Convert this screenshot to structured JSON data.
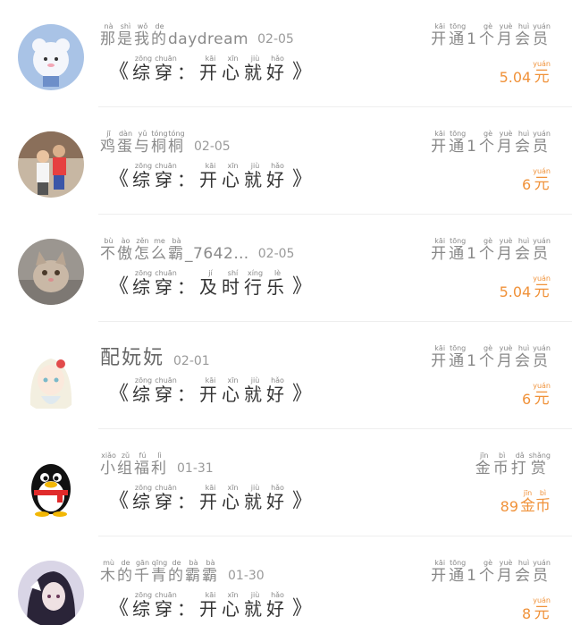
{
  "rows": [
    {
      "name_ruby": [
        [
          "那",
          "nà"
        ],
        [
          "是",
          "shì"
        ],
        [
          "我",
          "wǒ"
        ],
        [
          "的",
          "de"
        ]
      ],
      "name_tail": "daydream",
      "date": "02-05",
      "work": [
        [
          "综",
          "zōng"
        ],
        [
          "穿",
          "chuān"
        ],
        [
          "：",
          ""
        ],
        [
          "开",
          "kāi"
        ],
        [
          "心",
          "xīn"
        ],
        [
          "就",
          "jiù"
        ],
        [
          "好",
          "hǎo"
        ]
      ],
      "action": [
        [
          "开",
          "kāi"
        ],
        [
          "通",
          "tōng"
        ],
        [
          "1",
          ""
        ],
        [
          "个",
          "gè"
        ],
        [
          "月",
          "yuè"
        ],
        [
          "会",
          "huì"
        ],
        [
          "员",
          "yuán"
        ]
      ],
      "amount": "5.04",
      "currency": [
        [
          "元",
          "yuán"
        ]
      ],
      "avatar": "cloud-bear-icon"
    },
    {
      "name_ruby": [
        [
          "鸡",
          "jī"
        ],
        [
          "蛋",
          "dàn"
        ],
        [
          "与",
          "yǔ"
        ],
        [
          "桐",
          "tóng"
        ],
        [
          "桐",
          "tóng"
        ]
      ],
      "name_tail": "",
      "date": "02-05",
      "work": [
        [
          "综",
          "zōng"
        ],
        [
          "穿",
          "chuān"
        ],
        [
          "：",
          ""
        ],
        [
          "开",
          "kāi"
        ],
        [
          "心",
          "xīn"
        ],
        [
          "就",
          "jiù"
        ],
        [
          "好",
          "hǎo"
        ]
      ],
      "action": [
        [
          "开",
          "kāi"
        ],
        [
          "通",
          "tōng"
        ],
        [
          "1",
          ""
        ],
        [
          "个",
          "gè"
        ],
        [
          "月",
          "yuè"
        ],
        [
          "会",
          "huì"
        ],
        [
          "员",
          "yuán"
        ]
      ],
      "amount": "6",
      "currency": [
        [
          "元",
          "yuán"
        ]
      ],
      "avatar": "kids-photo-icon"
    },
    {
      "name_ruby": [
        [
          "不",
          "bù"
        ],
        [
          "傲",
          "ào"
        ],
        [
          "怎",
          "zěn"
        ],
        [
          "么",
          "me"
        ],
        [
          "霸",
          "bà"
        ]
      ],
      "name_tail": "_7642…",
      "date": "02-05",
      "work": [
        [
          "综",
          "zōng"
        ],
        [
          "穿",
          "chuān"
        ],
        [
          "：",
          ""
        ],
        [
          "及",
          "jí"
        ],
        [
          "时",
          "shí"
        ],
        [
          "行",
          "xíng"
        ],
        [
          "乐",
          "lè"
        ]
      ],
      "action": [
        [
          "开",
          "kāi"
        ],
        [
          "通",
          "tōng"
        ],
        [
          "1",
          ""
        ],
        [
          "个",
          "gè"
        ],
        [
          "月",
          "yuè"
        ],
        [
          "会",
          "huì"
        ],
        [
          "员",
          "yuán"
        ]
      ],
      "amount": "5.04",
      "currency": [
        [
          "元",
          "yuán"
        ]
      ],
      "avatar": "cat-photo-icon"
    },
    {
      "name_plain": "配妧妧",
      "date": "02-01",
      "work": [
        [
          "综",
          "zōng"
        ],
        [
          "穿",
          "chuān"
        ],
        [
          "：",
          ""
        ],
        [
          "开",
          "kāi"
        ],
        [
          "心",
          "xīn"
        ],
        [
          "就",
          "jiù"
        ],
        [
          "好",
          "hǎo"
        ]
      ],
      "action": [
        [
          "开",
          "kāi"
        ],
        [
          "通",
          "tōng"
        ],
        [
          "1",
          ""
        ],
        [
          "个",
          "gè"
        ],
        [
          "月",
          "yuè"
        ],
        [
          "会",
          "huì"
        ],
        [
          "员",
          "yuán"
        ]
      ],
      "amount": "6",
      "currency": [
        [
          "元",
          "yuán"
        ]
      ],
      "avatar": "anime-girl-icon"
    },
    {
      "name_ruby": [
        [
          "小",
          "xiǎo"
        ],
        [
          "组",
          "zǔ"
        ],
        [
          "福",
          "fú"
        ],
        [
          "利",
          "lì"
        ]
      ],
      "name_tail": "",
      "date": "01-31",
      "work": [
        [
          "综",
          "zōng"
        ],
        [
          "穿",
          "chuān"
        ],
        [
          "：",
          ""
        ],
        [
          "开",
          "kāi"
        ],
        [
          "心",
          "xīn"
        ],
        [
          "就",
          "jiù"
        ],
        [
          "好",
          "hǎo"
        ]
      ],
      "action": [
        [
          "金",
          "jīn"
        ],
        [
          "币",
          "bì"
        ],
        [
          "打",
          "dǎ"
        ],
        [
          "赏",
          "shǎng"
        ]
      ],
      "amount": "89",
      "currency": [
        [
          "金",
          "jīn"
        ],
        [
          "币",
          "bì"
        ]
      ],
      "avatar": "qq-penguin-icon"
    },
    {
      "name_ruby": [
        [
          "木",
          "mù"
        ],
        [
          "的",
          "de"
        ],
        [
          "千",
          "gān"
        ],
        [
          "青",
          "qīng"
        ],
        [
          "的",
          "de"
        ],
        [
          "霸",
          "bà"
        ],
        [
          "霸",
          "bà"
        ]
      ],
      "name_tail": "",
      "date": "01-30",
      "work": [
        [
          "综",
          "zōng"
        ],
        [
          "穿",
          "chuān"
        ],
        [
          "：",
          ""
        ],
        [
          "开",
          "kāi"
        ],
        [
          "心",
          "xīn"
        ],
        [
          "就",
          "jiù"
        ],
        [
          "好",
          "hǎo"
        ]
      ],
      "action": [
        [
          "开",
          "kāi"
        ],
        [
          "通",
          "tōng"
        ],
        [
          "1",
          ""
        ],
        [
          "个",
          "gè"
        ],
        [
          "月",
          "yuè"
        ],
        [
          "会",
          "huì"
        ],
        [
          "员",
          "yuán"
        ]
      ],
      "amount": "8",
      "currency": [
        [
          "元",
          "yuán"
        ]
      ],
      "avatar": "dark-anime-icon"
    }
  ]
}
